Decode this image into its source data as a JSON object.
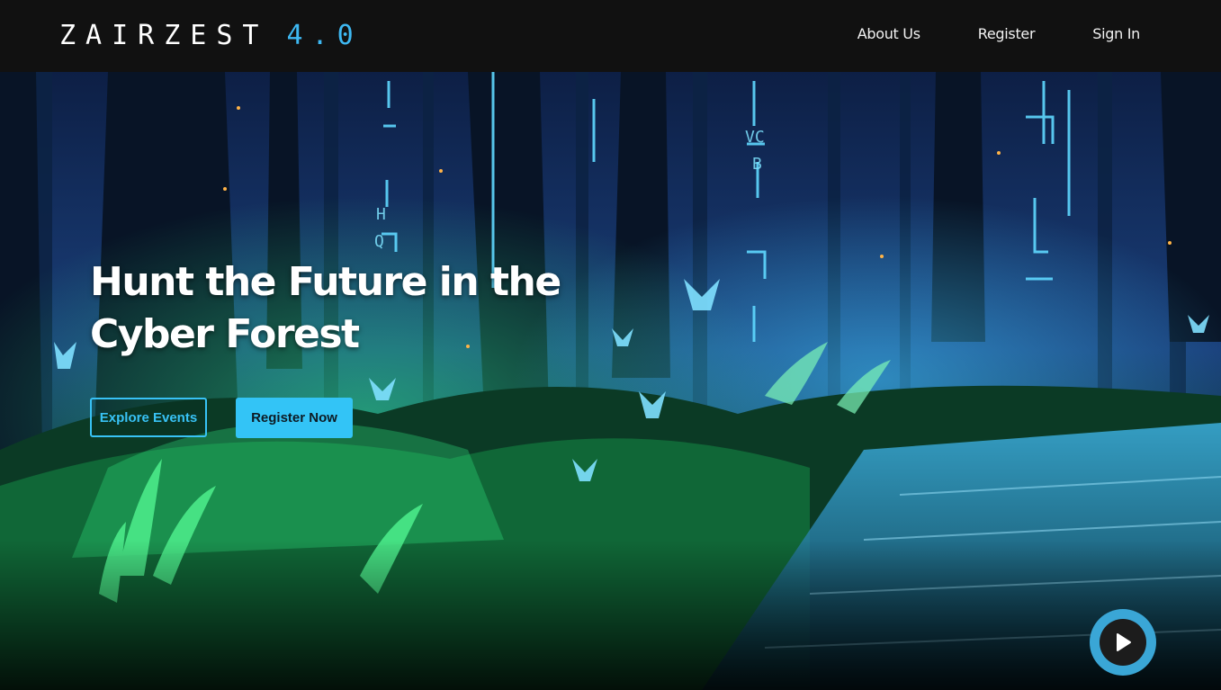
{
  "brand": {
    "name": "ZAIRZEST",
    "version": "4.0",
    "accent_color": "#3eb8f2"
  },
  "nav": {
    "items": [
      {
        "label": "About Us"
      },
      {
        "label": "Register"
      },
      {
        "label": "Sign In"
      }
    ]
  },
  "hero": {
    "title": "Hunt the Future in the Cyber Forest",
    "background": "glowing-cyber-forest-illustration",
    "primary_button": "Explore Events",
    "secondary_button": "Register Now",
    "button_color": "#33c4f6",
    "play_icon": "play-icon"
  }
}
